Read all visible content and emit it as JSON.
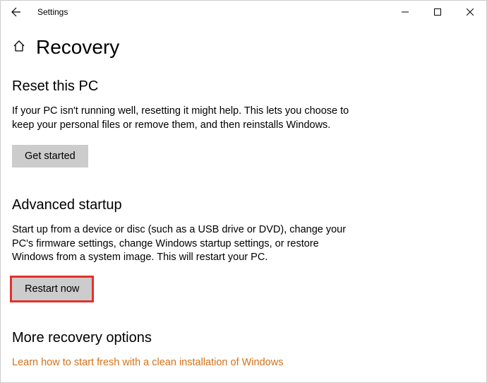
{
  "window": {
    "title": "Settings"
  },
  "page": {
    "title": "Recovery"
  },
  "sections": {
    "reset": {
      "title": "Reset this PC",
      "description": "If your PC isn't running well, resetting it might help. This lets you choose to keep your personal files or remove them, and then reinstalls Windows.",
      "button": "Get started"
    },
    "advanced": {
      "title": "Advanced startup",
      "description": "Start up from a device or disc (such as a USB drive or DVD), change your PC's firmware settings, change Windows startup settings, or restore Windows from a system image. This will restart your PC.",
      "button": "Restart now"
    },
    "more": {
      "title": "More recovery options",
      "link": "Learn how to start fresh with a clean installation of Windows"
    }
  }
}
